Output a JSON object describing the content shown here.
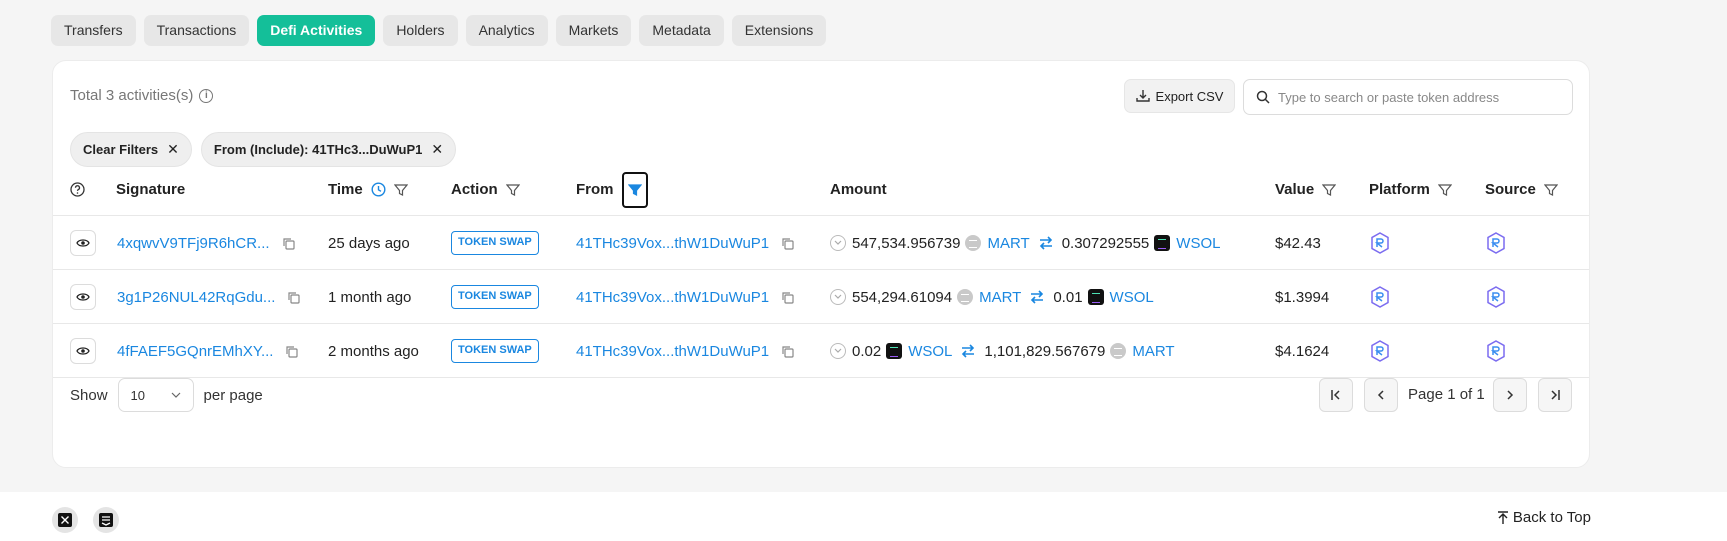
{
  "tabs": [
    "Transfers",
    "Transactions",
    "Defi Activities",
    "Holders",
    "Analytics",
    "Markets",
    "Metadata",
    "Extensions"
  ],
  "active_tab": "Defi Activities",
  "summary": {
    "total_text": "Total 3 activities(s)"
  },
  "toolbar": {
    "export_label": "Export CSV",
    "search_placeholder": "Type to search or paste token address"
  },
  "filters": {
    "clear_label": "Clear Filters",
    "active_filter": "From (Include): 41THc3...DuWuP1"
  },
  "columns": {
    "signature": "Signature",
    "time": "Time",
    "action": "Action",
    "from": "From",
    "amount": "Amount",
    "value": "Value",
    "platform": "Platform",
    "source": "Source"
  },
  "rows": [
    {
      "signature": "4xqwvV9TFj9R6hCR...",
      "time": "25 days ago",
      "action": "TOKEN SWAP",
      "from": "41THc39Vox...thW1DuWuP1",
      "in_amount": "547,534.956739",
      "in_token": "MART",
      "in_icon": "mart-token-icon",
      "out_amount": "0.307292555",
      "out_token": "WSOL",
      "out_icon": "wsol-token-icon",
      "value": "$42.43"
    },
    {
      "signature": "3g1P26NUL42RqGdu...",
      "time": "1 month ago",
      "action": "TOKEN SWAP",
      "from": "41THc39Vox...thW1DuWuP1",
      "in_amount": "554,294.61094",
      "in_token": "MART",
      "in_icon": "mart-token-icon",
      "out_amount": "0.01",
      "out_token": "WSOL",
      "out_icon": "wsol-token-icon",
      "value": "$1.3994"
    },
    {
      "signature": "4fFAEF5GQnrEMhXY...",
      "time": "2 months ago",
      "action": "TOKEN SWAP",
      "from": "41THc39Vox...thW1DuWuP1",
      "in_amount": "0.02",
      "in_token": "WSOL",
      "in_icon": "wsol-token-icon",
      "out_amount": "1,101,829.567679",
      "out_token": "MART",
      "out_icon": "mart-token-icon",
      "value": "$4.1624"
    }
  ],
  "pagination": {
    "show_label": "Show",
    "page_size": "10",
    "per_page_label": "per page",
    "page_text": "Page 1 of 1"
  },
  "footer": {
    "back_to_top": "Back to Top"
  },
  "colors": {
    "accent": "#14bf99",
    "link": "#1a87e0"
  }
}
